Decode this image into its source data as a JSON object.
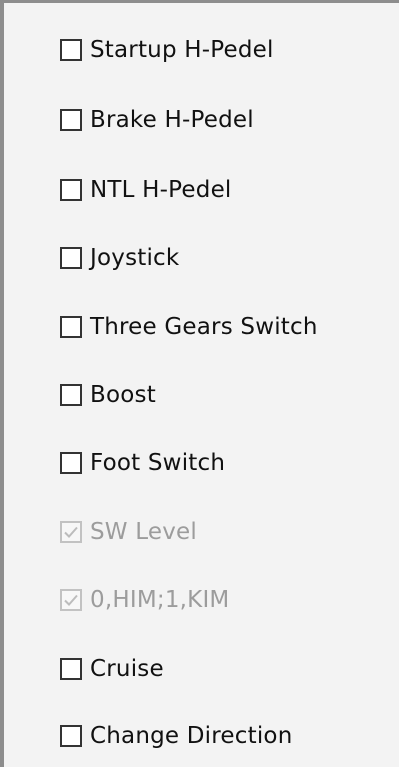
{
  "options": [
    {
      "label": "Startup H-Pedel",
      "checked": false,
      "disabled": false
    },
    {
      "label": "Brake H-Pedel",
      "checked": false,
      "disabled": false
    },
    {
      "label": "NTL H-Pedel",
      "checked": false,
      "disabled": false
    },
    {
      "label": "Joystick",
      "checked": false,
      "disabled": false
    },
    {
      "label": "Three Gears Switch",
      "checked": false,
      "disabled": false
    },
    {
      "label": "Boost",
      "checked": false,
      "disabled": false
    },
    {
      "label": "Foot Switch",
      "checked": false,
      "disabled": false
    },
    {
      "label": "SW Level",
      "checked": true,
      "disabled": true
    },
    {
      "label": "0,HIM;1,KIM",
      "checked": true,
      "disabled": true
    },
    {
      "label": "Cruise",
      "checked": false,
      "disabled": false
    },
    {
      "label": "Change Direction",
      "checked": false,
      "disabled": false
    }
  ]
}
